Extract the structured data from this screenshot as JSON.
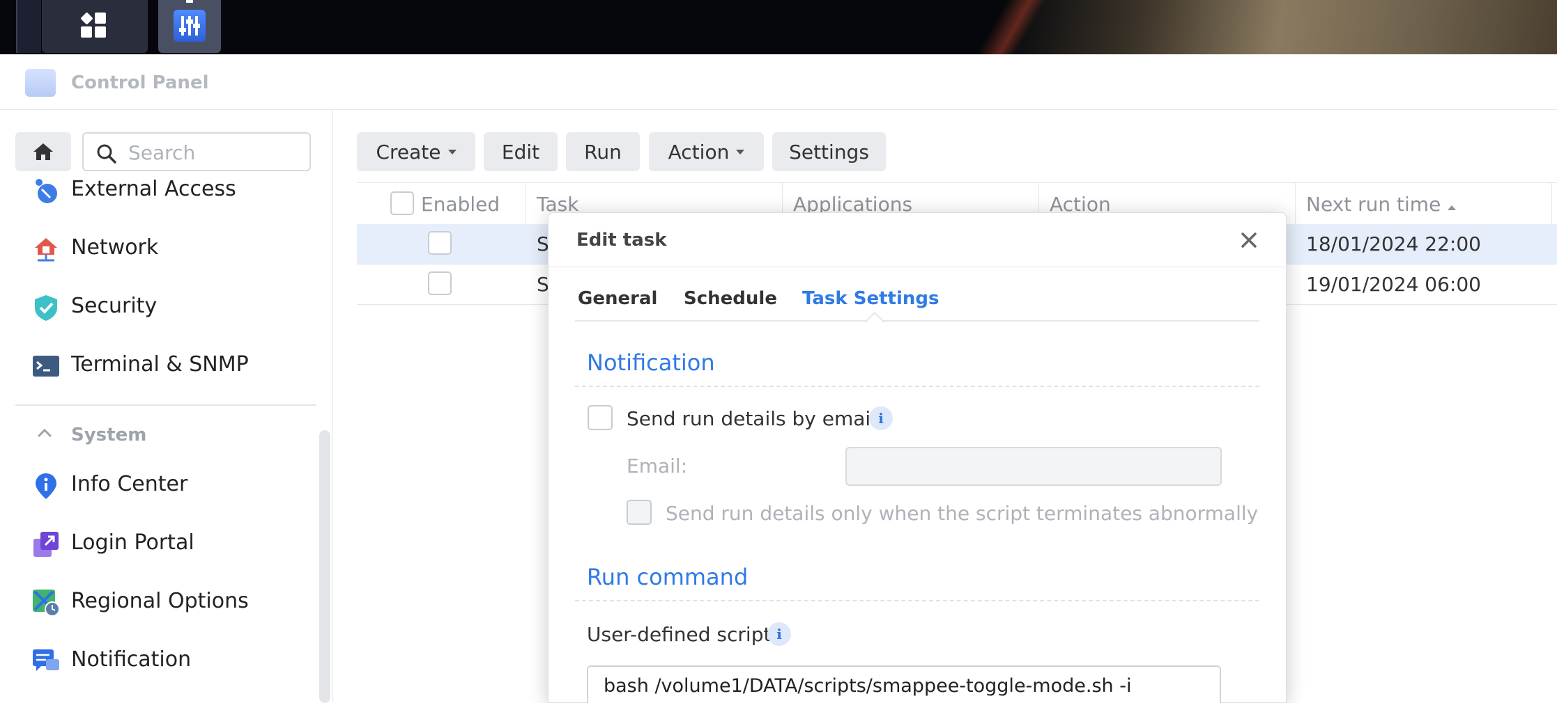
{
  "window": {
    "title": "Control Panel"
  },
  "search": {
    "placeholder": "Search"
  },
  "sidebar": {
    "items": [
      {
        "label": "External Access",
        "icon": "external-access-icon"
      },
      {
        "label": "Network",
        "icon": "network-icon"
      },
      {
        "label": "Security",
        "icon": "security-shield-icon"
      },
      {
        "label": "Terminal & SNMP",
        "icon": "terminal-icon"
      }
    ],
    "section": {
      "label": "System",
      "expanded": true
    },
    "system_items": [
      {
        "label": "Info Center",
        "icon": "info-center-icon"
      },
      {
        "label": "Login Portal",
        "icon": "login-portal-icon"
      },
      {
        "label": "Regional Options",
        "icon": "regional-options-icon"
      },
      {
        "label": "Notification",
        "icon": "notification-icon"
      }
    ]
  },
  "toolbar": {
    "create_label": "Create",
    "edit_label": "Edit",
    "run_label": "Run",
    "action_label": "Action",
    "settings_label": "Settings"
  },
  "table": {
    "columns": [
      "Enabled",
      "Task",
      "Applications",
      "Action",
      "Next run time"
    ],
    "sort_column": "Next run time",
    "sort_direction": "ascending",
    "rows": [
      {
        "task_partial": "S",
        "next_run": "18/01/2024 22:00",
        "selected": true,
        "enabled": false
      },
      {
        "task_partial": "S",
        "next_run": "19/01/2024 06:00",
        "selected": false,
        "enabled": false
      }
    ]
  },
  "dialog": {
    "title": "Edit task",
    "tabs": [
      "General",
      "Schedule",
      "Task Settings"
    ],
    "active_tab": "Task Settings",
    "notification": {
      "heading": "Notification",
      "send_email_label": "Send run details by email",
      "send_email_checked": false,
      "email_label": "Email:",
      "email_value": "",
      "abnormal_only_label": "Send run details only when the script terminates abnormally",
      "abnormal_only_checked": false
    },
    "run_command": {
      "heading": "Run command",
      "script_label": "User-defined script",
      "script_value": "bash /volume1/DATA/scripts/smappee-toggle-mode.sh -i"
    }
  },
  "colors": {
    "accent": "#2f7ae5",
    "selected_row": "#e6eefb",
    "taskbar": "#05070c"
  }
}
